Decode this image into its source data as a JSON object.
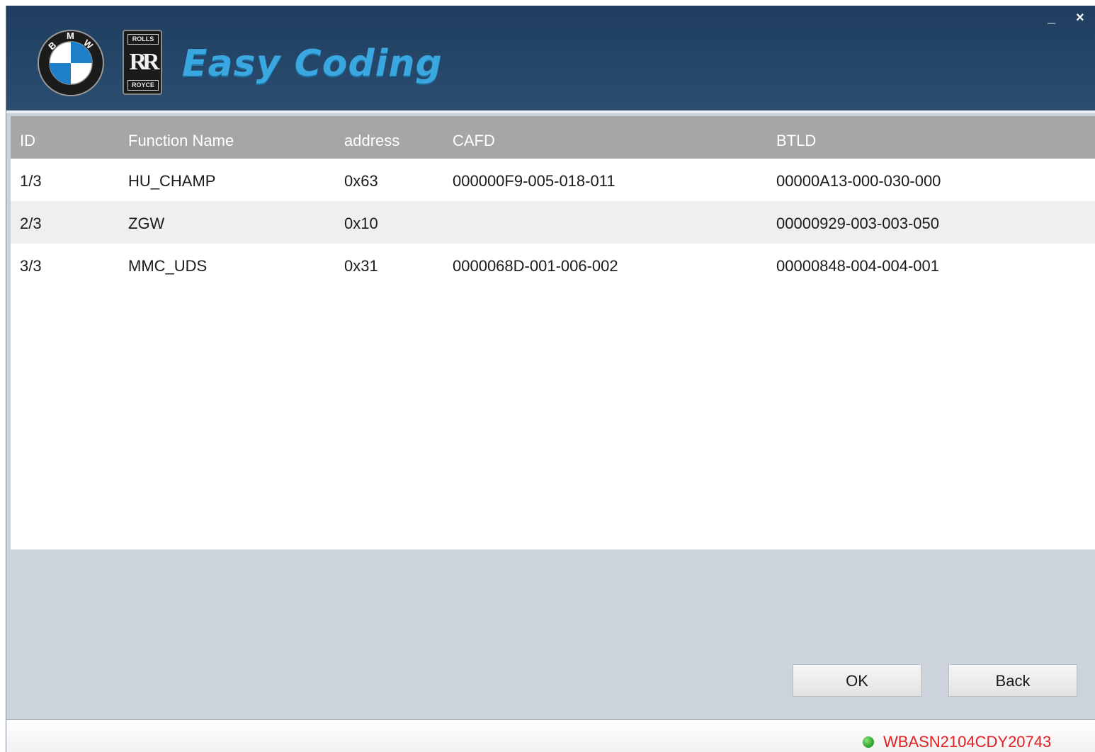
{
  "app": {
    "brand": "Easy Coding",
    "bmw_letters": [
      "B",
      "M",
      "W"
    ],
    "rr_top": "ROLLS",
    "rr_monogram": "RR",
    "rr_bottom": "ROYCE"
  },
  "window_controls": {
    "minimize": "_",
    "close": "×"
  },
  "table": {
    "headers": {
      "id": "ID",
      "function_name": "Function Name",
      "address": "address",
      "cafd": "CAFD",
      "btld": "BTLD"
    },
    "rows": [
      {
        "id": "1/3",
        "function_name": "HU_CHAMP",
        "address": "0x63",
        "cafd": "000000F9-005-018-011",
        "btld": "00000A13-000-030-000"
      },
      {
        "id": "2/3",
        "function_name": "ZGW",
        "address": "0x10",
        "cafd": "",
        "btld": "00000929-003-003-050"
      },
      {
        "id": "3/3",
        "function_name": "MMC_UDS",
        "address": "0x31",
        "cafd": "0000068D-001-006-002",
        "btld": "00000848-004-004-001"
      }
    ]
  },
  "buttons": {
    "ok": "OK",
    "back": "Back"
  },
  "status": {
    "vin": "WBASN2104CDY20743",
    "connected_color": "#2fa82f",
    "vin_color": "#e02020"
  }
}
